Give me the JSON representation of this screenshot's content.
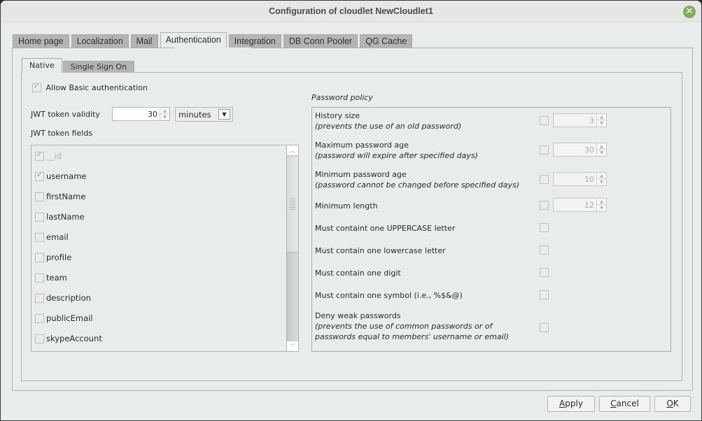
{
  "window": {
    "title": "Configuration of cloudlet NewCloudlet1",
    "close_icon": "close-icon"
  },
  "tabs": [
    {
      "label": "Home page",
      "active": false
    },
    {
      "label": "Localization",
      "active": false
    },
    {
      "label": "Mail",
      "active": false
    },
    {
      "label": "Authentication",
      "active": true
    },
    {
      "label": "Integration",
      "active": false
    },
    {
      "label": "DB Conn Pooler",
      "active": false
    },
    {
      "label": "QG Cache",
      "active": false
    }
  ],
  "subtabs": [
    {
      "label": "Native",
      "active": true
    },
    {
      "label": "Single Sign On",
      "active": false
    }
  ],
  "native": {
    "allow_basic_label": "Allow Basic authentication",
    "allow_basic_checked": true,
    "jwt_validity_label": "JWT token validity",
    "jwt_validity_value": "30",
    "jwt_validity_unit": "minutes",
    "jwt_fields_label": "JWT token fields",
    "jwt_fields": [
      {
        "label": "__id",
        "checked": true,
        "disabled": true
      },
      {
        "label": "username",
        "checked": true,
        "disabled": false
      },
      {
        "label": "firstName",
        "checked": false,
        "disabled": false
      },
      {
        "label": "lastName",
        "checked": false,
        "disabled": false
      },
      {
        "label": "email",
        "checked": false,
        "disabled": false
      },
      {
        "label": "profile",
        "checked": false,
        "disabled": false
      },
      {
        "label": "team",
        "checked": false,
        "disabled": false
      },
      {
        "label": "description",
        "checked": false,
        "disabled": false
      },
      {
        "label": "publicEmail",
        "checked": false,
        "disabled": false
      },
      {
        "label": "skypeAccount",
        "checked": false,
        "disabled": false
      }
    ]
  },
  "password_policy": {
    "legend": "Password policy",
    "rows": [
      {
        "label": "History size",
        "sub": "(prevents the use of an old password)",
        "checked": false,
        "value": "3"
      },
      {
        "label": "Maximum password age",
        "sub": "(password will expire after specified days)",
        "checked": false,
        "value": "30"
      },
      {
        "label": "Minimum password age",
        "sub": "(password cannot be changed before specified days)",
        "checked": false,
        "value": "10"
      },
      {
        "label": "Minimum length",
        "sub": "",
        "checked": false,
        "value": "12"
      },
      {
        "label": "Must containt one UPPERCASE letter",
        "sub": "",
        "checked": false
      },
      {
        "label": "Must contain one lowercase letter",
        "sub": "",
        "checked": false
      },
      {
        "label": "Must contain one digit",
        "sub": "",
        "checked": false
      },
      {
        "label": "Must contain one symbol (i.e., %$&@)",
        "sub": "",
        "checked": false
      },
      {
        "label": "Deny weak passwords",
        "sub": "(prevents the use of common passwords or of",
        "sub2": "passwords equal to members' username or email)",
        "checked": false
      }
    ]
  },
  "buttons": {
    "apply_mnemonic": "A",
    "apply_rest": "pply",
    "cancel_mnemonic": "C",
    "cancel_rest": "ancel",
    "ok_mnemonic": "O",
    "ok_rest": "K"
  }
}
